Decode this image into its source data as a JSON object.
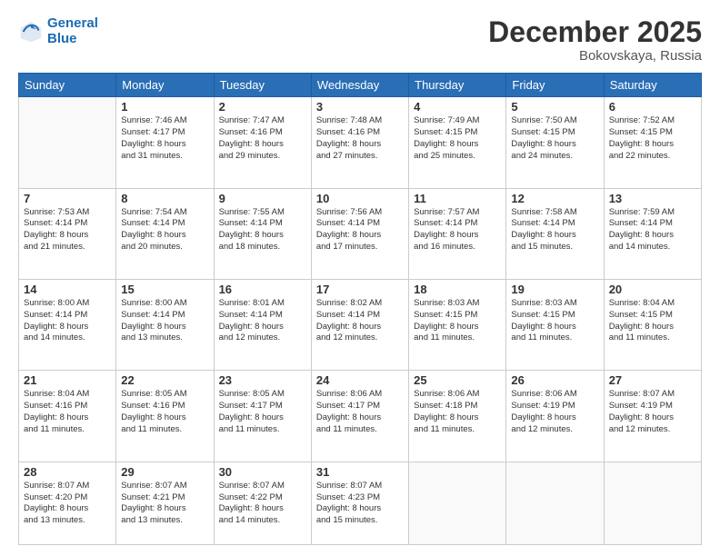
{
  "logo": {
    "line1": "General",
    "line2": "Blue"
  },
  "title": "December 2025",
  "location": "Bokovskaya, Russia",
  "weekdays": [
    "Sunday",
    "Monday",
    "Tuesday",
    "Wednesday",
    "Thursday",
    "Friday",
    "Saturday"
  ],
  "weeks": [
    [
      {
        "day": "",
        "info": ""
      },
      {
        "day": "1",
        "info": "Sunrise: 7:46 AM\nSunset: 4:17 PM\nDaylight: 8 hours\nand 31 minutes."
      },
      {
        "day": "2",
        "info": "Sunrise: 7:47 AM\nSunset: 4:16 PM\nDaylight: 8 hours\nand 29 minutes."
      },
      {
        "day": "3",
        "info": "Sunrise: 7:48 AM\nSunset: 4:16 PM\nDaylight: 8 hours\nand 27 minutes."
      },
      {
        "day": "4",
        "info": "Sunrise: 7:49 AM\nSunset: 4:15 PM\nDaylight: 8 hours\nand 25 minutes."
      },
      {
        "day": "5",
        "info": "Sunrise: 7:50 AM\nSunset: 4:15 PM\nDaylight: 8 hours\nand 24 minutes."
      },
      {
        "day": "6",
        "info": "Sunrise: 7:52 AM\nSunset: 4:15 PM\nDaylight: 8 hours\nand 22 minutes."
      }
    ],
    [
      {
        "day": "7",
        "info": "Sunrise: 7:53 AM\nSunset: 4:14 PM\nDaylight: 8 hours\nand 21 minutes."
      },
      {
        "day": "8",
        "info": "Sunrise: 7:54 AM\nSunset: 4:14 PM\nDaylight: 8 hours\nand 20 minutes."
      },
      {
        "day": "9",
        "info": "Sunrise: 7:55 AM\nSunset: 4:14 PM\nDaylight: 8 hours\nand 18 minutes."
      },
      {
        "day": "10",
        "info": "Sunrise: 7:56 AM\nSunset: 4:14 PM\nDaylight: 8 hours\nand 17 minutes."
      },
      {
        "day": "11",
        "info": "Sunrise: 7:57 AM\nSunset: 4:14 PM\nDaylight: 8 hours\nand 16 minutes."
      },
      {
        "day": "12",
        "info": "Sunrise: 7:58 AM\nSunset: 4:14 PM\nDaylight: 8 hours\nand 15 minutes."
      },
      {
        "day": "13",
        "info": "Sunrise: 7:59 AM\nSunset: 4:14 PM\nDaylight: 8 hours\nand 14 minutes."
      }
    ],
    [
      {
        "day": "14",
        "info": "Sunrise: 8:00 AM\nSunset: 4:14 PM\nDaylight: 8 hours\nand 14 minutes."
      },
      {
        "day": "15",
        "info": "Sunrise: 8:00 AM\nSunset: 4:14 PM\nDaylight: 8 hours\nand 13 minutes."
      },
      {
        "day": "16",
        "info": "Sunrise: 8:01 AM\nSunset: 4:14 PM\nDaylight: 8 hours\nand 12 minutes."
      },
      {
        "day": "17",
        "info": "Sunrise: 8:02 AM\nSunset: 4:14 PM\nDaylight: 8 hours\nand 12 minutes."
      },
      {
        "day": "18",
        "info": "Sunrise: 8:03 AM\nSunset: 4:15 PM\nDaylight: 8 hours\nand 11 minutes."
      },
      {
        "day": "19",
        "info": "Sunrise: 8:03 AM\nSunset: 4:15 PM\nDaylight: 8 hours\nand 11 minutes."
      },
      {
        "day": "20",
        "info": "Sunrise: 8:04 AM\nSunset: 4:15 PM\nDaylight: 8 hours\nand 11 minutes."
      }
    ],
    [
      {
        "day": "21",
        "info": "Sunrise: 8:04 AM\nSunset: 4:16 PM\nDaylight: 8 hours\nand 11 minutes."
      },
      {
        "day": "22",
        "info": "Sunrise: 8:05 AM\nSunset: 4:16 PM\nDaylight: 8 hours\nand 11 minutes."
      },
      {
        "day": "23",
        "info": "Sunrise: 8:05 AM\nSunset: 4:17 PM\nDaylight: 8 hours\nand 11 minutes."
      },
      {
        "day": "24",
        "info": "Sunrise: 8:06 AM\nSunset: 4:17 PM\nDaylight: 8 hours\nand 11 minutes."
      },
      {
        "day": "25",
        "info": "Sunrise: 8:06 AM\nSunset: 4:18 PM\nDaylight: 8 hours\nand 11 minutes."
      },
      {
        "day": "26",
        "info": "Sunrise: 8:06 AM\nSunset: 4:19 PM\nDaylight: 8 hours\nand 12 minutes."
      },
      {
        "day": "27",
        "info": "Sunrise: 8:07 AM\nSunset: 4:19 PM\nDaylight: 8 hours\nand 12 minutes."
      }
    ],
    [
      {
        "day": "28",
        "info": "Sunrise: 8:07 AM\nSunset: 4:20 PM\nDaylight: 8 hours\nand 13 minutes."
      },
      {
        "day": "29",
        "info": "Sunrise: 8:07 AM\nSunset: 4:21 PM\nDaylight: 8 hours\nand 13 minutes."
      },
      {
        "day": "30",
        "info": "Sunrise: 8:07 AM\nSunset: 4:22 PM\nDaylight: 8 hours\nand 14 minutes."
      },
      {
        "day": "31",
        "info": "Sunrise: 8:07 AM\nSunset: 4:23 PM\nDaylight: 8 hours\nand 15 minutes."
      },
      {
        "day": "",
        "info": ""
      },
      {
        "day": "",
        "info": ""
      },
      {
        "day": "",
        "info": ""
      }
    ]
  ]
}
